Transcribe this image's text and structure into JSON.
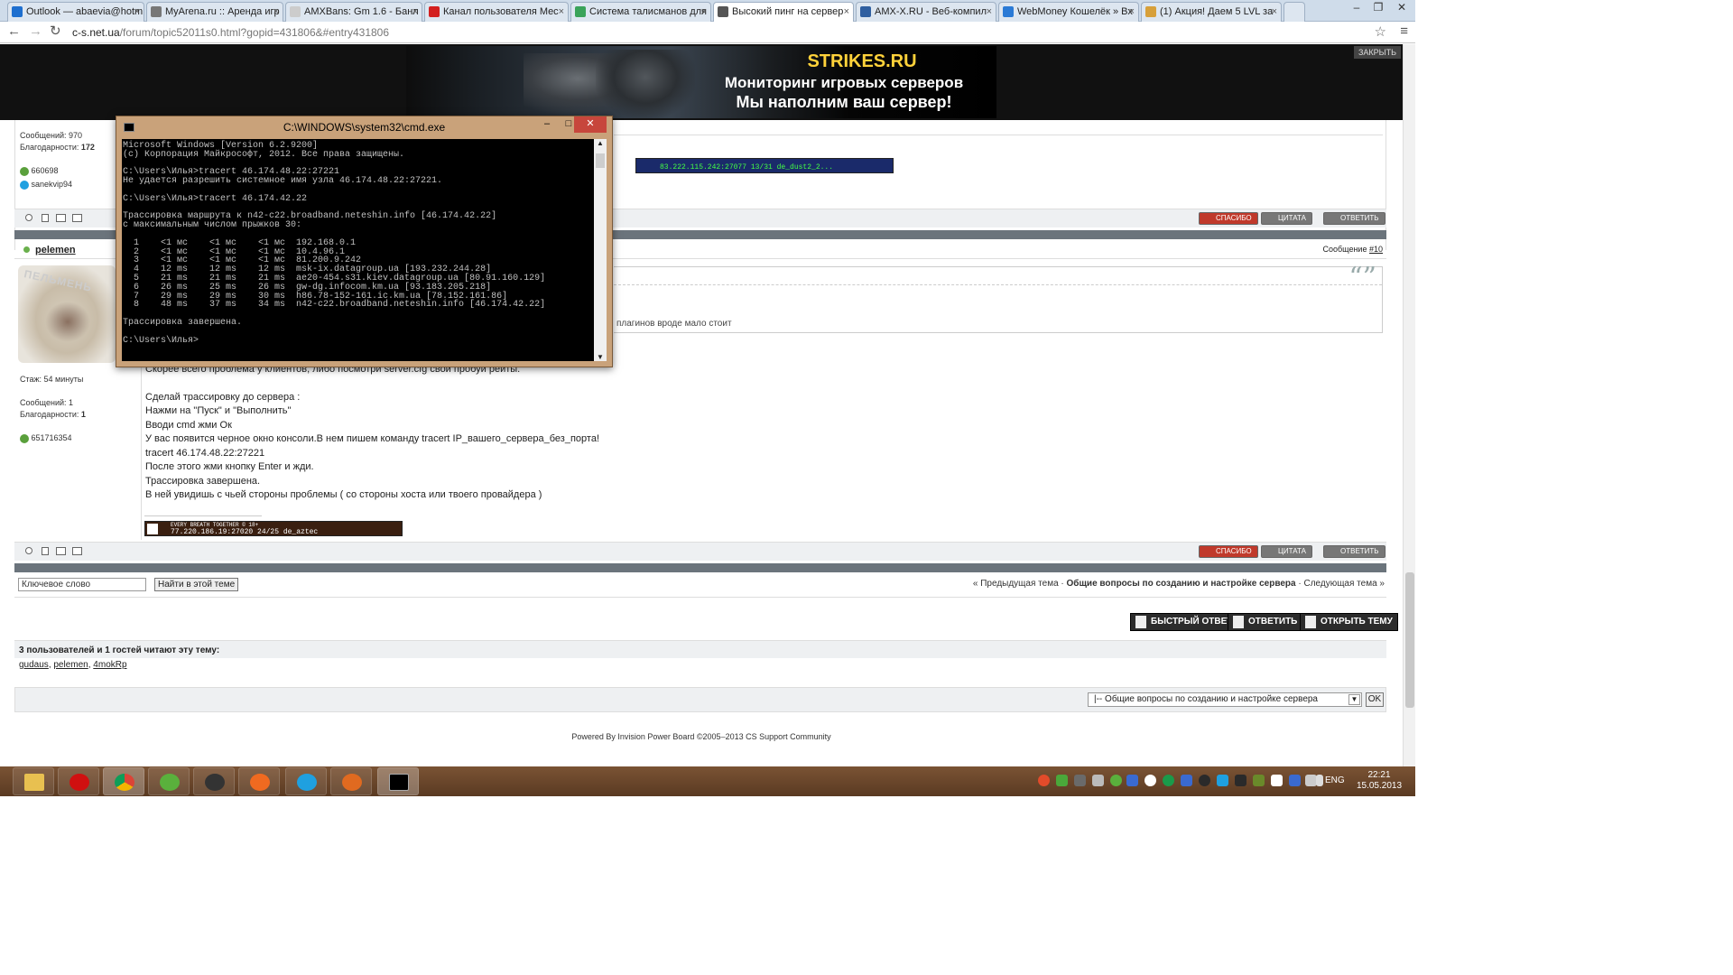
{
  "browser": {
    "tabs": [
      {
        "title": "Outlook — abaevia@hotm",
        "color": "#1e6fcf"
      },
      {
        "title": "MyArena.ru :: Аренда игр",
        "color": "#777777"
      },
      {
        "title": "AMXBans: Gm 1.6 - Банл",
        "color": "#aaaaaa"
      },
      {
        "title": "Канал пользователя Mec",
        "color": "#d32020"
      },
      {
        "title": "Система талисманов для",
        "color": "#3aa35a"
      },
      {
        "title": "Высокий пинг на сервер",
        "color": "#555555"
      },
      {
        "title": "AMX-X.RU - Веб-компил",
        "color": "#2f5fa0"
      },
      {
        "title": "WebMoney Кошелёк » Вх",
        "color": "#2a7ad6"
      },
      {
        "title": "(1) Акция! Даем 5 LVL за",
        "color": "#d7a03a"
      }
    ],
    "url_host": "c-s.net.ua",
    "url_path": "/forum/topic52011s0.html?gopid=431806&#entry431806"
  },
  "ad": {
    "brand": "STRIKES.RU",
    "line1": "Мониторинг игровых серверов",
    "line2": "Мы наполним ваш сервер!",
    "close": "ЗАКРЫТЬ"
  },
  "prev_post": {
    "messages": "Сообщений: 970",
    "thanks_label": "Благодарности:",
    "thanks": "172",
    "icq": "660698",
    "skype": "sanekvip94",
    "sig_text": "83.222.115.242:27077  13/31  de_dust2_2..."
  },
  "buttons": {
    "thanks": "спасибо",
    "quote": "цитата",
    "reply": "ответить"
  },
  "post": {
    "author": "pelemen",
    "post_no_label": "Сообщение",
    "post_no": "#10",
    "avatar_text": "ПЕЛЬМЕНЬ",
    "tenure": "Стаж: 54 минуты",
    "messages": "Сообщений: 1",
    "thanks_label": "Благодарности:",
    "thanks": "1",
    "icq": "651716354",
    "quote_tail": "плагинов вроде мало стоит",
    "lines": [
      "Скорее всего проблема у клиентов, либо посмотри server.cfg свой пробуй рейты.",
      "",
      "Сделай трассировку до сервера :",
      "Нажми на \"Пуск\" и \"Выполнить\"",
      "Вводи cmd жми Ок",
      "У вас появится черное окно консоли.В нем пишем команду tracert IP_вашего_сервера_без_порта!",
      "tracert 46.174.48.22:27221",
      "После этого жми кнопку Enter и жди.",
      "Трассировка завершена.",
      "В ней увидишь с чьей стороны проблемы ( со стороны хоста или твоего провайдера )"
    ],
    "sig_line1": "EVERY BREATH TOGETHER © 18+",
    "sig_line2": "77.220.186.19:27020   24/25   de_aztec"
  },
  "cmd": {
    "title": "C:\\WINDOWS\\system32\\cmd.exe",
    "output": "Microsoft Windows [Version 6.2.9200]\n(c) Корпорация Майкрософт, 2012. Все права защищены.\n\nC:\\Users\\Илья>tracert 46.174.48.22:27221\nНе удается разрешить системное имя узла 46.174.48.22:27221.\n\nC:\\Users\\Илья>tracert 46.174.42.22\n\nТрассировка маршрута к n42-c22.broadband.neteshin.info [46.174.42.22]\nс максимальным числом прыжков 30:\n\n  1    <1 мс    <1 мс    <1 мс  192.168.0.1\n  2    <1 мс    <1 мс    <1 мс  10.4.96.1\n  3    <1 мс    <1 мс    <1 мс  81.200.9.242\n  4    12 ms    12 ms    12 ms  msk-ix.datagroup.ua [193.232.244.28]\n  5    21 ms    21 ms    21 ms  ae20-454.s31.kiev.datagroup.ua [80.91.160.129]\n  6    26 ms    25 ms    26 ms  gw-dg.infocom.km.ua [93.183.205.218]\n  7    29 ms    29 ms    30 ms  h86.78-152-161.ic.km.ua [78.152.161.86]\n  8    48 ms    37 ms    34 ms  n42-c22.broadband.neteshin.info [46.174.42.22]\n\nТрассировка завершена.\n\nC:\\Users\\Илья>"
  },
  "search": {
    "placeholder": "Ключевое слово",
    "button": "Найти в этой теме"
  },
  "topic_nav": {
    "prev": "« Предыдущая тема",
    "sep": " · ",
    "forum": "Общие вопросы по созданию и настройке сервера",
    "next": "Следующая тема »"
  },
  "actions": {
    "quick_reply": "БЫСТРЫЙ ОТВЕТ",
    "reply": "ОТВЕТИТЬ",
    "new_topic": "ОТКРЫТЬ ТЕМУ"
  },
  "readers": {
    "title": "3 пользователей и 1 гостей читают эту тему:",
    "users": [
      "gudaus",
      "pelemen",
      "4mokRp"
    ]
  },
  "jump": {
    "selected": "|-- Общие вопросы по созданию и настройке сервера",
    "ok": "OK"
  },
  "footer": {
    "powered": "Powered By Invision Power Board  ©2005–2013  CS Support Community"
  },
  "taskbar": {
    "lang": "ENG",
    "time": "22:21",
    "date": "15.05.2013"
  }
}
